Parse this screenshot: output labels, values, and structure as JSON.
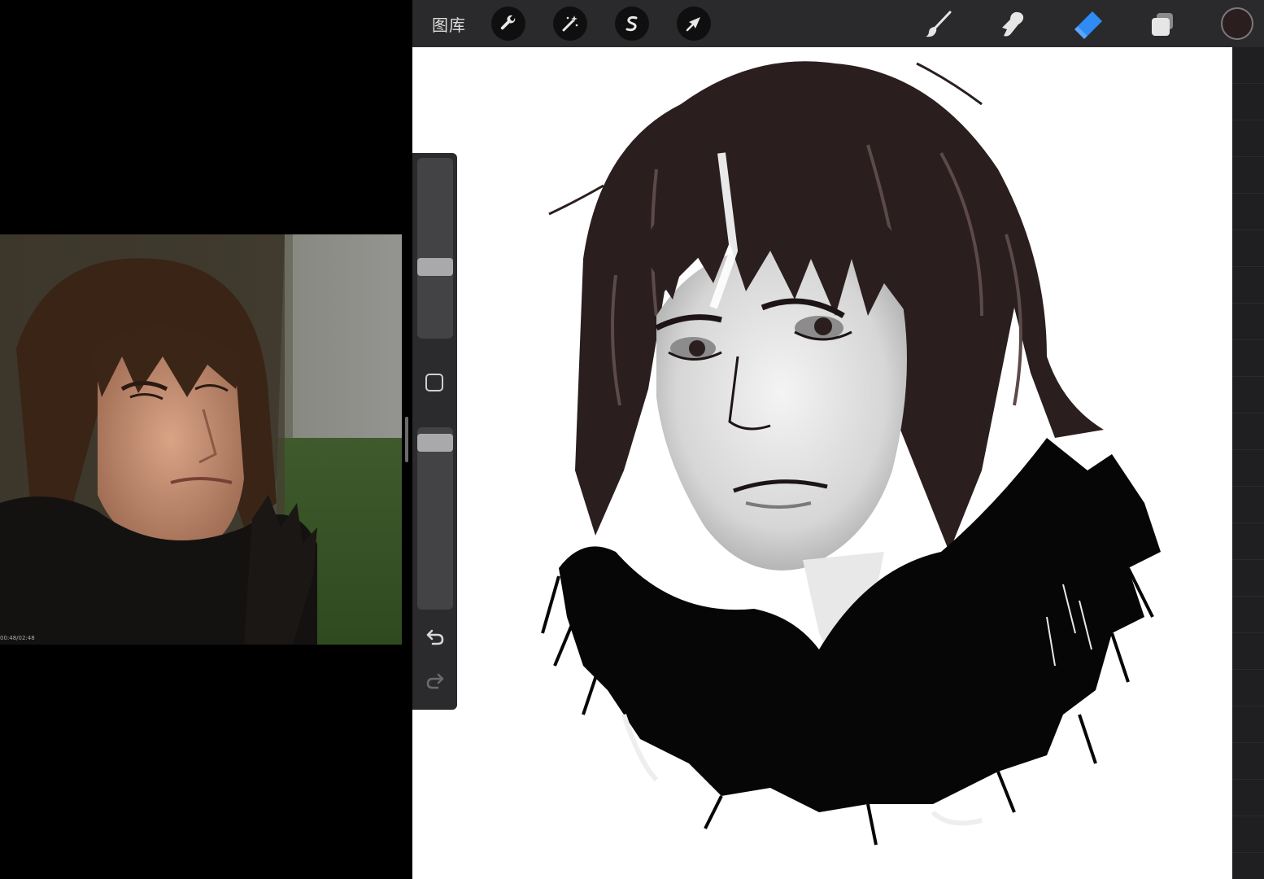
{
  "reference": {
    "timecode": "00:48/02:48"
  },
  "toolbar": {
    "gallery_label": "图库",
    "left_tools": [
      "wrench-icon",
      "magic-wand-icon",
      "selection-s-icon",
      "transform-arrow-icon"
    ],
    "right_tools": [
      "brush-icon",
      "smudge-icon",
      "eraser-icon",
      "layers-icon"
    ],
    "active_tool": "eraser",
    "accent_color": "#2f8cf5",
    "current_color": "#2b1e1f"
  },
  "sidebar": {
    "brush_size_level": 0.3,
    "opacity_level": 0.05,
    "controls": [
      "brush-size-slider",
      "modify-button",
      "opacity-slider",
      "undo-icon",
      "redo-icon"
    ]
  }
}
